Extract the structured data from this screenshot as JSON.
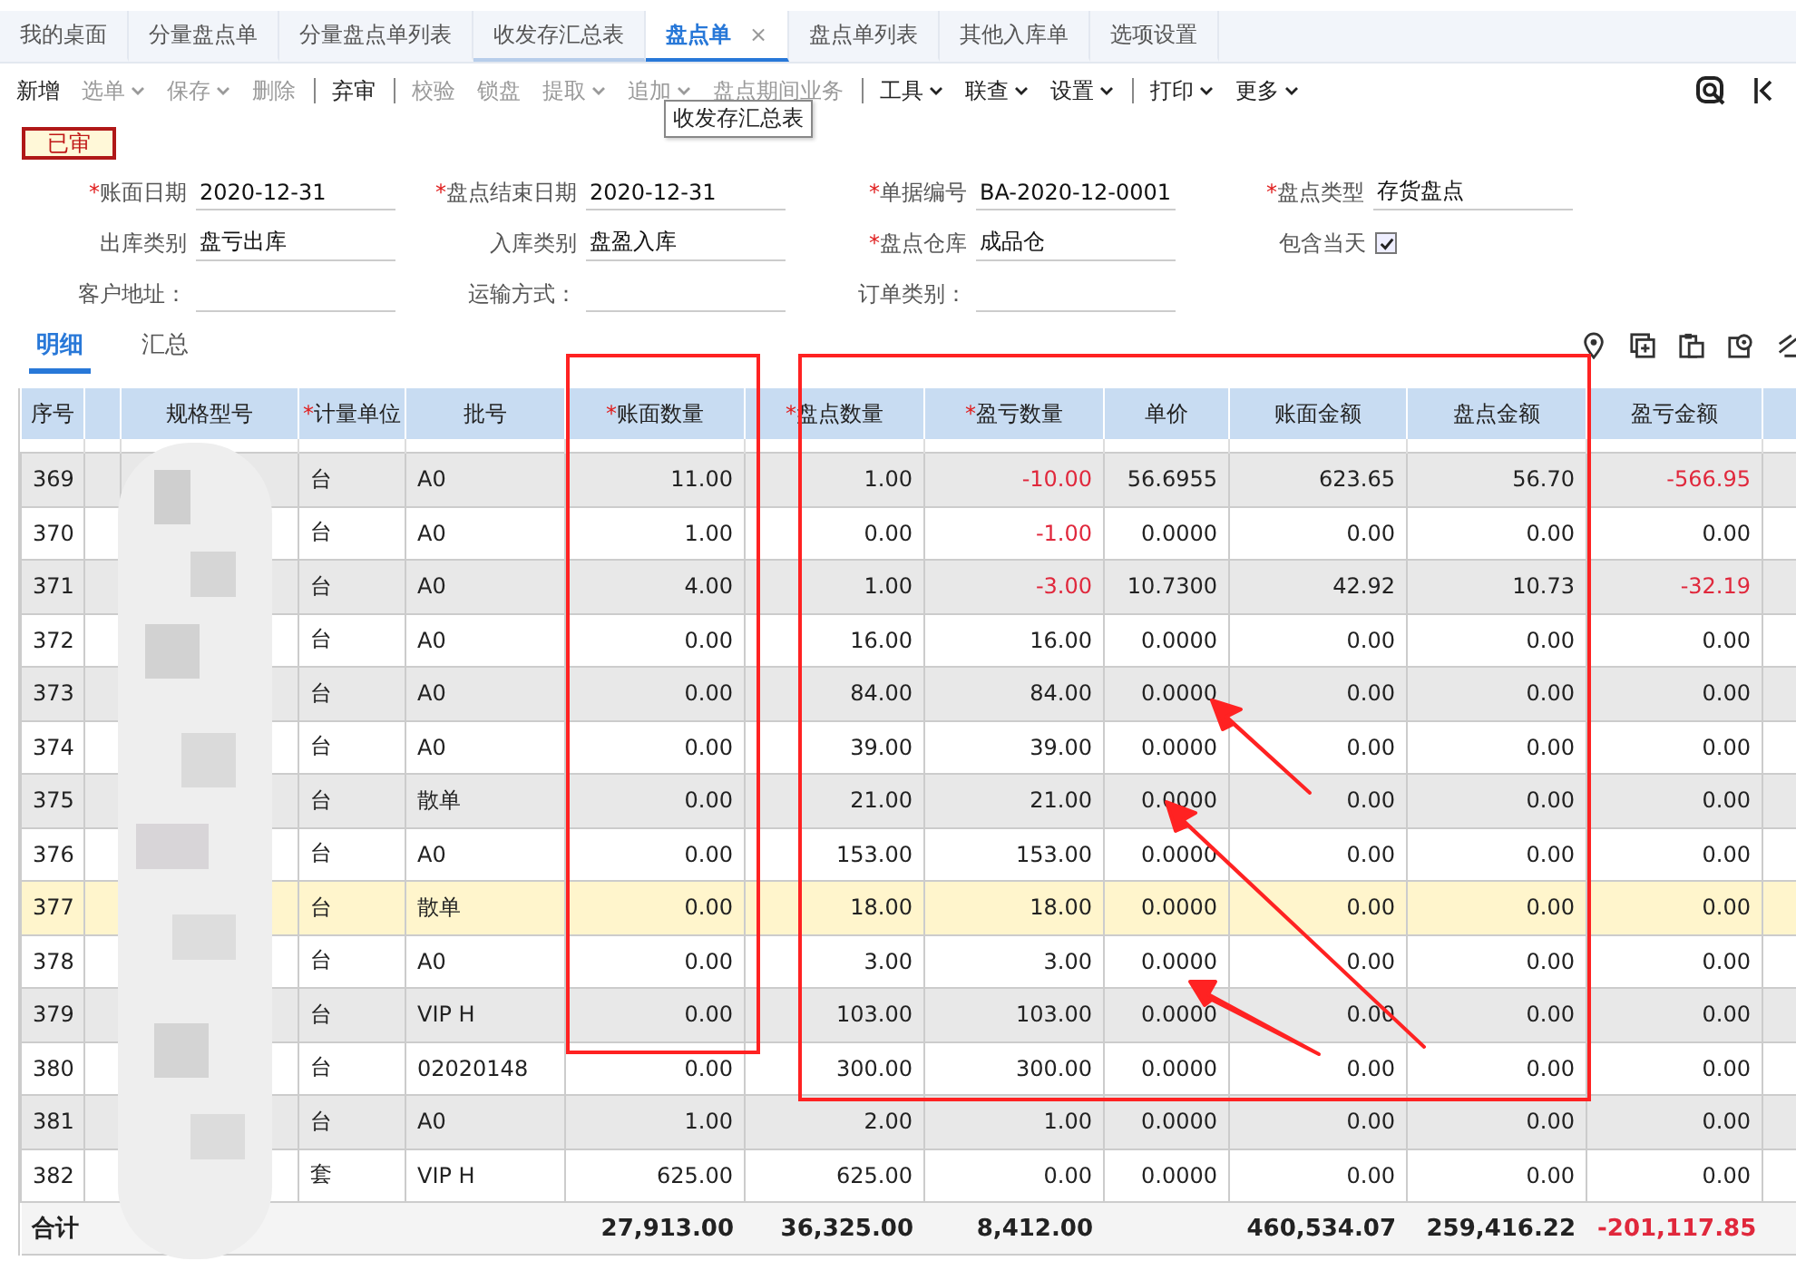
{
  "tabs": [
    {
      "label": "我的桌面",
      "selected": false,
      "hovered": false,
      "closable": false
    },
    {
      "label": "分量盘点单",
      "selected": false,
      "hovered": false,
      "closable": false
    },
    {
      "label": "分量盘点单列表",
      "selected": false,
      "hovered": false,
      "closable": false
    },
    {
      "label": "收发存汇总表",
      "selected": false,
      "hovered": true,
      "closable": false
    },
    {
      "label": "盘点单",
      "selected": true,
      "hovered": false,
      "closable": true,
      "close": "×"
    },
    {
      "label": "盘点单列表",
      "selected": false,
      "hovered": false,
      "closable": false
    },
    {
      "label": "其他入库单",
      "selected": false,
      "hovered": false,
      "closable": false
    },
    {
      "label": "选项设置",
      "selected": false,
      "hovered": false,
      "closable": false
    }
  ],
  "toolbar": [
    {
      "label": "新增",
      "disabled": false,
      "dropdown": false,
      "divider_before": false
    },
    {
      "label": "选单",
      "disabled": true,
      "dropdown": true,
      "divider_before": false
    },
    {
      "label": "保存",
      "disabled": true,
      "dropdown": true,
      "divider_before": false
    },
    {
      "label": "删除",
      "disabled": true,
      "dropdown": false,
      "divider_before": false
    },
    {
      "label": "弃审",
      "disabled": false,
      "dropdown": false,
      "divider_before": true
    },
    {
      "label": "校验",
      "disabled": true,
      "dropdown": false,
      "divider_before": true
    },
    {
      "label": "锁盘",
      "disabled": true,
      "dropdown": false,
      "divider_before": false
    },
    {
      "label": "提取",
      "disabled": true,
      "dropdown": true,
      "divider_before": false
    },
    {
      "label": "追加",
      "disabled": true,
      "dropdown": true,
      "divider_before": false
    },
    {
      "label": "盘点期间业务",
      "disabled": true,
      "dropdown": false,
      "divider_before": false
    },
    {
      "label": "工具",
      "disabled": false,
      "dropdown": true,
      "divider_before": true
    },
    {
      "label": "联查",
      "disabled": false,
      "dropdown": true,
      "divider_before": false
    },
    {
      "label": "设置",
      "disabled": false,
      "dropdown": true,
      "divider_before": false
    },
    {
      "label": "打印",
      "disabled": false,
      "dropdown": true,
      "divider_before": true
    },
    {
      "label": "更多",
      "disabled": false,
      "dropdown": true,
      "divider_before": false
    }
  ],
  "tooltip": "收发存汇总表",
  "status_stamp": "已审",
  "form_rows": [
    [
      {
        "mark": "*",
        "label": "账面日期",
        "kind": "text",
        "value": "2020-12-31"
      },
      {
        "mark": "*",
        "label": "盘点结束日期",
        "kind": "text",
        "value": "2020-12-31"
      },
      {
        "mark": "*",
        "label": "单据编号",
        "kind": "text",
        "value": "BA-2020-12-0001"
      },
      {
        "mark": "*",
        "label": "盘点类型",
        "kind": "text",
        "value": "存货盘点"
      }
    ],
    [
      {
        "label": "出库类别",
        "kind": "text",
        "value": "盘亏出库"
      },
      {
        "label": "入库类别",
        "kind": "text",
        "value": "盘盈入库"
      },
      {
        "mark": "*",
        "label": "盘点仓库",
        "kind": "text",
        "value": "成品仓"
      },
      {
        "label": "包含当天",
        "kind": "checkbox",
        "checked": true
      }
    ],
    [
      {
        "label": "客户地址：",
        "kind": "text"
      },
      {
        "label": "运输方式：",
        "kind": "text"
      },
      {
        "label": "订单类别：",
        "kind": "text"
      }
    ]
  ],
  "sub_tabs": [
    {
      "label": "明细",
      "selected": true
    },
    {
      "label": "汇总",
      "selected": false
    }
  ],
  "table": {
    "columns": [
      {
        "label": "序号"
      },
      {},
      {
        "label": "规格型号"
      },
      {
        "mark": "*",
        "label": "计量单位"
      },
      {
        "label": "批号"
      },
      {
        "mark": "*",
        "label": "账面数量"
      },
      {
        "mark": "*",
        "label": "盘点数量"
      },
      {
        "mark": "*",
        "label": "盈亏数量"
      },
      {
        "label": "单价"
      },
      {
        "label": "账面金额"
      },
      {
        "label": "盘点金额"
      },
      {
        "label": "盈亏金额"
      }
    ],
    "rows": [
      {
        "no": "369",
        "unit": "台",
        "batch": "A0",
        "book_qty": "11.00",
        "count_qty": "1.00",
        "diff_qty": "-10.00",
        "price": "56.6955",
        "book_amount": "623.65",
        "count_amount": "56.70",
        "diff_amount": "-566.95",
        "selected": false,
        "diff_qty_loss": true,
        "diff_amount_loss": true
      },
      {
        "no": "370",
        "unit": "台",
        "batch": "A0",
        "book_qty": "1.00",
        "count_qty": "0.00",
        "diff_qty": "-1.00",
        "price": "0.0000",
        "book_amount": "0.00",
        "count_amount": "0.00",
        "diff_amount": "0.00",
        "selected": false,
        "diff_qty_loss": true,
        "diff_amount_loss": false
      },
      {
        "no": "371",
        "unit": "台",
        "batch": "A0",
        "book_qty": "4.00",
        "count_qty": "1.00",
        "diff_qty": "-3.00",
        "price": "10.7300",
        "book_amount": "42.92",
        "count_amount": "10.73",
        "diff_amount": "-32.19",
        "selected": false,
        "diff_qty_loss": true,
        "diff_amount_loss": true
      },
      {
        "no": "372",
        "unit": "台",
        "batch": "A0",
        "book_qty": "0.00",
        "count_qty": "16.00",
        "diff_qty": "16.00",
        "price": "0.0000",
        "book_amount": "0.00",
        "count_amount": "0.00",
        "diff_amount": "0.00",
        "selected": false,
        "diff_qty_loss": false,
        "diff_amount_loss": false
      },
      {
        "no": "373",
        "unit": "台",
        "batch": "A0",
        "book_qty": "0.00",
        "count_qty": "84.00",
        "diff_qty": "84.00",
        "price": "0.0000",
        "book_amount": "0.00",
        "count_amount": "0.00",
        "diff_amount": "0.00",
        "selected": false,
        "diff_qty_loss": false,
        "diff_amount_loss": false
      },
      {
        "no": "374",
        "unit": "台",
        "batch": "A0",
        "book_qty": "0.00",
        "count_qty": "39.00",
        "diff_qty": "39.00",
        "price": "0.0000",
        "book_amount": "0.00",
        "count_amount": "0.00",
        "diff_amount": "0.00",
        "selected": false,
        "diff_qty_loss": false,
        "diff_amount_loss": false
      },
      {
        "no": "375",
        "unit": "台",
        "batch": "散单",
        "book_qty": "0.00",
        "count_qty": "21.00",
        "diff_qty": "21.00",
        "price": "0.0000",
        "book_amount": "0.00",
        "count_amount": "0.00",
        "diff_amount": "0.00",
        "selected": false,
        "diff_qty_loss": false,
        "diff_amount_loss": false
      },
      {
        "no": "376",
        "unit": "台",
        "batch": "A0",
        "book_qty": "0.00",
        "count_qty": "153.00",
        "diff_qty": "153.00",
        "price": "0.0000",
        "book_amount": "0.00",
        "count_amount": "0.00",
        "diff_amount": "0.00",
        "selected": false,
        "diff_qty_loss": false,
        "diff_amount_loss": false
      },
      {
        "no": "377",
        "unit": "台",
        "batch": "散单",
        "book_qty": "0.00",
        "count_qty": "18.00",
        "diff_qty": "18.00",
        "price": "0.0000",
        "book_amount": "0.00",
        "count_amount": "0.00",
        "diff_amount": "0.00",
        "selected": true,
        "diff_qty_loss": false,
        "diff_amount_loss": false
      },
      {
        "no": "378",
        "unit": "台",
        "batch": "A0",
        "book_qty": "0.00",
        "count_qty": "3.00",
        "diff_qty": "3.00",
        "price": "0.0000",
        "book_amount": "0.00",
        "count_amount": "0.00",
        "diff_amount": "0.00",
        "selected": false,
        "diff_qty_loss": false,
        "diff_amount_loss": false
      },
      {
        "no": "379",
        "unit": "台",
        "batch": "VIP H",
        "book_qty": "0.00",
        "count_qty": "103.00",
        "diff_qty": "103.00",
        "price": "0.0000",
        "book_amount": "0.00",
        "count_amount": "0.00",
        "diff_amount": "0.00",
        "selected": false,
        "diff_qty_loss": false,
        "diff_amount_loss": false
      },
      {
        "no": "380",
        "unit": "台",
        "batch": "02020148",
        "book_qty": "0.00",
        "count_qty": "300.00",
        "diff_qty": "300.00",
        "price": "0.0000",
        "book_amount": "0.00",
        "count_amount": "0.00",
        "diff_amount": "0.00",
        "selected": false,
        "diff_qty_loss": false,
        "diff_amount_loss": false
      },
      {
        "no": "381",
        "unit": "台",
        "batch": "A0",
        "book_qty": "1.00",
        "count_qty": "2.00",
        "diff_qty": "1.00",
        "price": "0.0000",
        "book_amount": "0.00",
        "count_amount": "0.00",
        "diff_amount": "0.00",
        "selected": false,
        "diff_qty_loss": false,
        "diff_amount_loss": false
      },
      {
        "no": "382",
        "unit": "套",
        "batch": "VIP H",
        "book_qty": "625.00",
        "count_qty": "625.00",
        "diff_qty": "0.00",
        "price": "0.0000",
        "book_amount": "0.00",
        "count_amount": "0.00",
        "diff_amount": "0.00",
        "selected": false,
        "diff_qty_loss": false,
        "diff_amount_loss": false
      }
    ],
    "totals": {
      "label": "合计",
      "book_qty": "27,913.00",
      "count_qty": "36,325.00",
      "diff_qty": "8,412.00",
      "book_amount": "460,534.07",
      "count_amount": "259,416.22",
      "diff_amount": "-201,117.85",
      "diff_amount_loss": true
    }
  }
}
